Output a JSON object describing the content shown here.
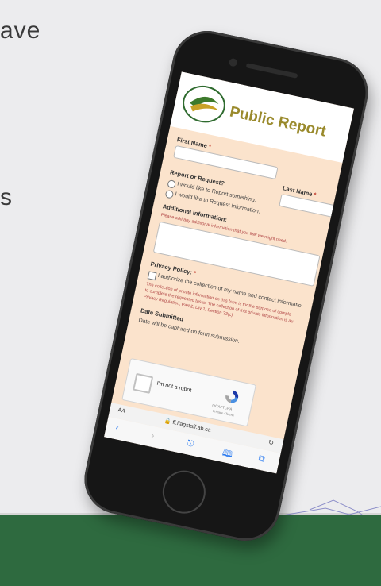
{
  "background": {
    "partial_text_top": "ave",
    "partial_text_mid": "s",
    "colors": {
      "bottom_band": "#2e6a3f",
      "background": "#ececee"
    }
  },
  "form": {
    "title": "Public Report",
    "first_name_label": "First Name",
    "last_name_label": "Last Name",
    "required_marker": "*",
    "report_label": "Report or Request?",
    "option_report": "I would like to Report something.",
    "option_request": "I would like to Request Information.",
    "additional_label": "Additional Information:",
    "additional_note": "Please add any additional information that you feel we might need.",
    "privacy_label": "Privacy Policy:",
    "privacy_option": "I authorize the collection of my name and contact informatio",
    "privacy_note_1": "The collection of private information on this form is for the purpose of comple",
    "privacy_note_2": "to complete the requested tasks. The collection of this private information is au",
    "privacy_note_3": "Privacy Regulation, Part 2, Div 1, Section 33(c)",
    "date_label": "Date Submitted",
    "date_text": "Date will be captured on form submission."
  },
  "captcha": {
    "label": "I'm not a robot",
    "brand": "reCAPTCHA",
    "terms": "Privacy - Terms"
  },
  "browser": {
    "text_size": "AA",
    "url": "🔒 ff.flagstaff.ab.ca",
    "reload_glyph": "↻",
    "back_glyph": "‹",
    "forward_glyph": "›",
    "share_glyph": "⎋",
    "bookmarks_glyph": "🕮",
    "tabs_glyph": "⧉"
  }
}
